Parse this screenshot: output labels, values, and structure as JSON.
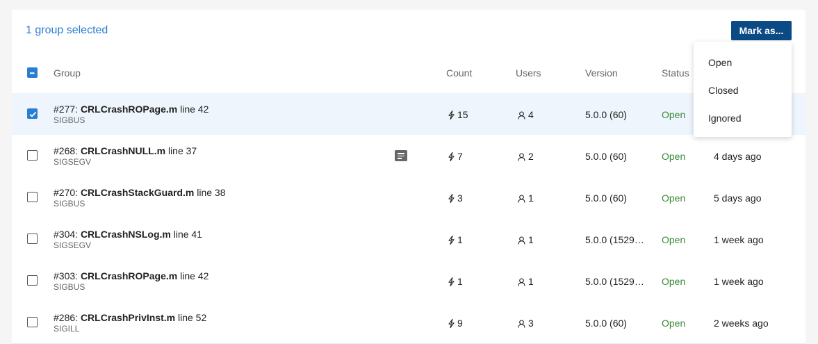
{
  "toolbar": {
    "selected_text": "1 group selected",
    "mark_label": "Mark as..."
  },
  "columns": {
    "group": "Group",
    "count": "Count",
    "users": "Users",
    "version": "Version",
    "status": "Status"
  },
  "menu": {
    "options": [
      "Open",
      "Closed",
      "Ignored"
    ]
  },
  "rows": [
    {
      "id": "#277:",
      "name": "CRLCrashROPage.m",
      "line": "line 42",
      "signal": "SIGBUS",
      "count": "15",
      "users": "4",
      "version": "5.0.0 (60)",
      "status": "Open",
      "last_seen": ""
    },
    {
      "id": "#268:",
      "name": "CRLCrashNULL.m",
      "line": "line 37",
      "signal": "SIGSEGV",
      "count": "7",
      "users": "2",
      "version": "5.0.0 (60)",
      "status": "Open",
      "last_seen": "4 days ago"
    },
    {
      "id": "#270:",
      "name": "CRLCrashStackGuard.m",
      "line": "line 38",
      "signal": "SIGBUS",
      "count": "3",
      "users": "1",
      "version": "5.0.0 (60)",
      "status": "Open",
      "last_seen": "5 days ago"
    },
    {
      "id": "#304:",
      "name": "CRLCrashNSLog.m",
      "line": "line 41",
      "signal": "SIGSEGV",
      "count": "1",
      "users": "1",
      "version": "5.0.0 (1529…",
      "status": "Open",
      "last_seen": "1 week ago"
    },
    {
      "id": "#303:",
      "name": "CRLCrashROPage.m",
      "line": "line 42",
      "signal": "SIGBUS",
      "count": "1",
      "users": "1",
      "version": "5.0.0 (1529…",
      "status": "Open",
      "last_seen": "1 week ago"
    },
    {
      "id": "#286:",
      "name": "CRLCrashPrivInst.m",
      "line": "line 52",
      "signal": "SIGILL",
      "count": "9",
      "users": "3",
      "version": "5.0.0 (60)",
      "status": "Open",
      "last_seen": "2 weeks ago"
    }
  ],
  "colors": {
    "accent": "#2a7ed2",
    "button": "#0b4a85",
    "status_open": "#3a8a36"
  }
}
